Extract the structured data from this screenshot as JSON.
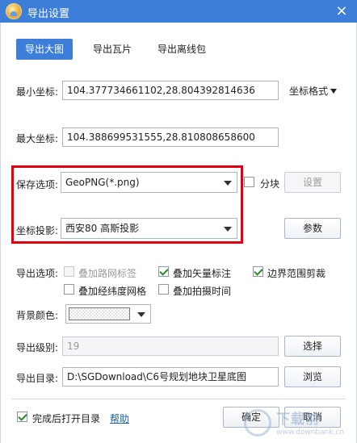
{
  "window": {
    "title": "导出设置",
    "close_label": "×"
  },
  "tabs": [
    {
      "label": "导出大图",
      "active": true
    },
    {
      "label": "导出瓦片",
      "active": false
    },
    {
      "label": "导出离线包",
      "active": false
    }
  ],
  "coords": {
    "min_label": "最小坐标:",
    "min_value": "104.377734661102,28.804392814636",
    "format_label": "坐标格式",
    "max_label": "最大坐标:",
    "max_value": "104.388699531555,28.810808658600"
  },
  "save": {
    "label": "保存选项:",
    "value": "GeoPNG(*.png)",
    "tile_label": "分块",
    "tile_checked": false,
    "settings_label": "设置"
  },
  "projection": {
    "label": "坐标投影:",
    "value": "西安80 高斯投影",
    "params_label": "参数"
  },
  "export_options": {
    "label": "导出选项:",
    "road_labels": {
      "label": "叠加路网标签",
      "checked": false,
      "enabled": false
    },
    "vector_labels": {
      "label": "叠加矢量标注",
      "checked": true,
      "enabled": true
    },
    "boundary_crop": {
      "label": "边界范围剪裁",
      "checked": true,
      "enabled": true
    },
    "graticule": {
      "label": "叠加经纬度网格",
      "checked": false,
      "enabled": true
    },
    "capture_time": {
      "label": "叠加拍摄时间",
      "checked": false,
      "enabled": true
    }
  },
  "background": {
    "label": "背景颜色:"
  },
  "level": {
    "label": "导出级别:",
    "value": "19",
    "select_label": "选择"
  },
  "directory": {
    "label": "导出目录:",
    "value": "D:\\SGDownload\\C6号规划地块卫星底图",
    "browse_label": "浏览"
  },
  "footer": {
    "open_dir_label": "完成后打开目录",
    "open_dir_checked": true,
    "help_label": "帮助",
    "ok_label": "确定",
    "cancel_label": "取消"
  },
  "watermark": {
    "text": "下载前",
    "url": "www.downbank.cn"
  },
  "colors": {
    "titlebar": "#3d7fd8",
    "highlight_box": "#e00012",
    "link": "#1a5fb8"
  }
}
